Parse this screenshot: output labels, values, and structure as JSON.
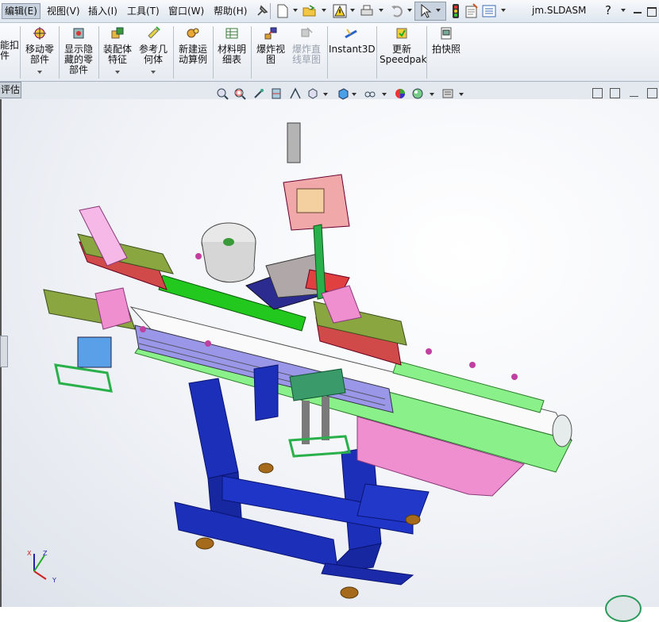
{
  "menubar": {
    "items": [
      {
        "label": "编辑(E)",
        "active": true
      },
      {
        "label": "视图(V)"
      },
      {
        "label": "插入(I)"
      },
      {
        "label": "工具(T)"
      },
      {
        "label": "窗口(W)"
      },
      {
        "label": "帮助(H)"
      }
    ],
    "document_title": "jm.SLDASM",
    "help_symbol": "?"
  },
  "command_manager": {
    "items": [
      {
        "line1": "能扣",
        "line2": "件"
      },
      {
        "line1": "移动零",
        "line2": "部件"
      },
      {
        "line1": "显示隐",
        "line2": "藏的零",
        "line3": "部件"
      },
      {
        "line1": "装配体",
        "line2": "特征"
      },
      {
        "line1": "参考几",
        "line2": "何体"
      },
      {
        "line1": "新建运",
        "line2": "动算例"
      },
      {
        "line1": "材料明",
        "line2": "细表"
      },
      {
        "line1": "爆炸视",
        "line2": "图"
      },
      {
        "line1": "爆炸直",
        "line2": "线草图"
      },
      {
        "line1": "Instant3D"
      },
      {
        "line1": "更新",
        "line2": "Speedpak"
      },
      {
        "line1": "拍快照"
      }
    ]
  },
  "tabstrip": {
    "tab_label": "评估"
  },
  "viewport": {
    "triad": {
      "x": "X",
      "y": "Y",
      "z": "Z"
    }
  },
  "colors": {
    "frame_blue": "#1c2fb8",
    "pink": "#f08fd0",
    "olive_green": "#8aa640",
    "bright_green": "#22c81e",
    "light_green": "#8af08a",
    "red_panel": "#d04a4a",
    "white_belt": "#fafafa",
    "lavender": "#9b97e8"
  }
}
